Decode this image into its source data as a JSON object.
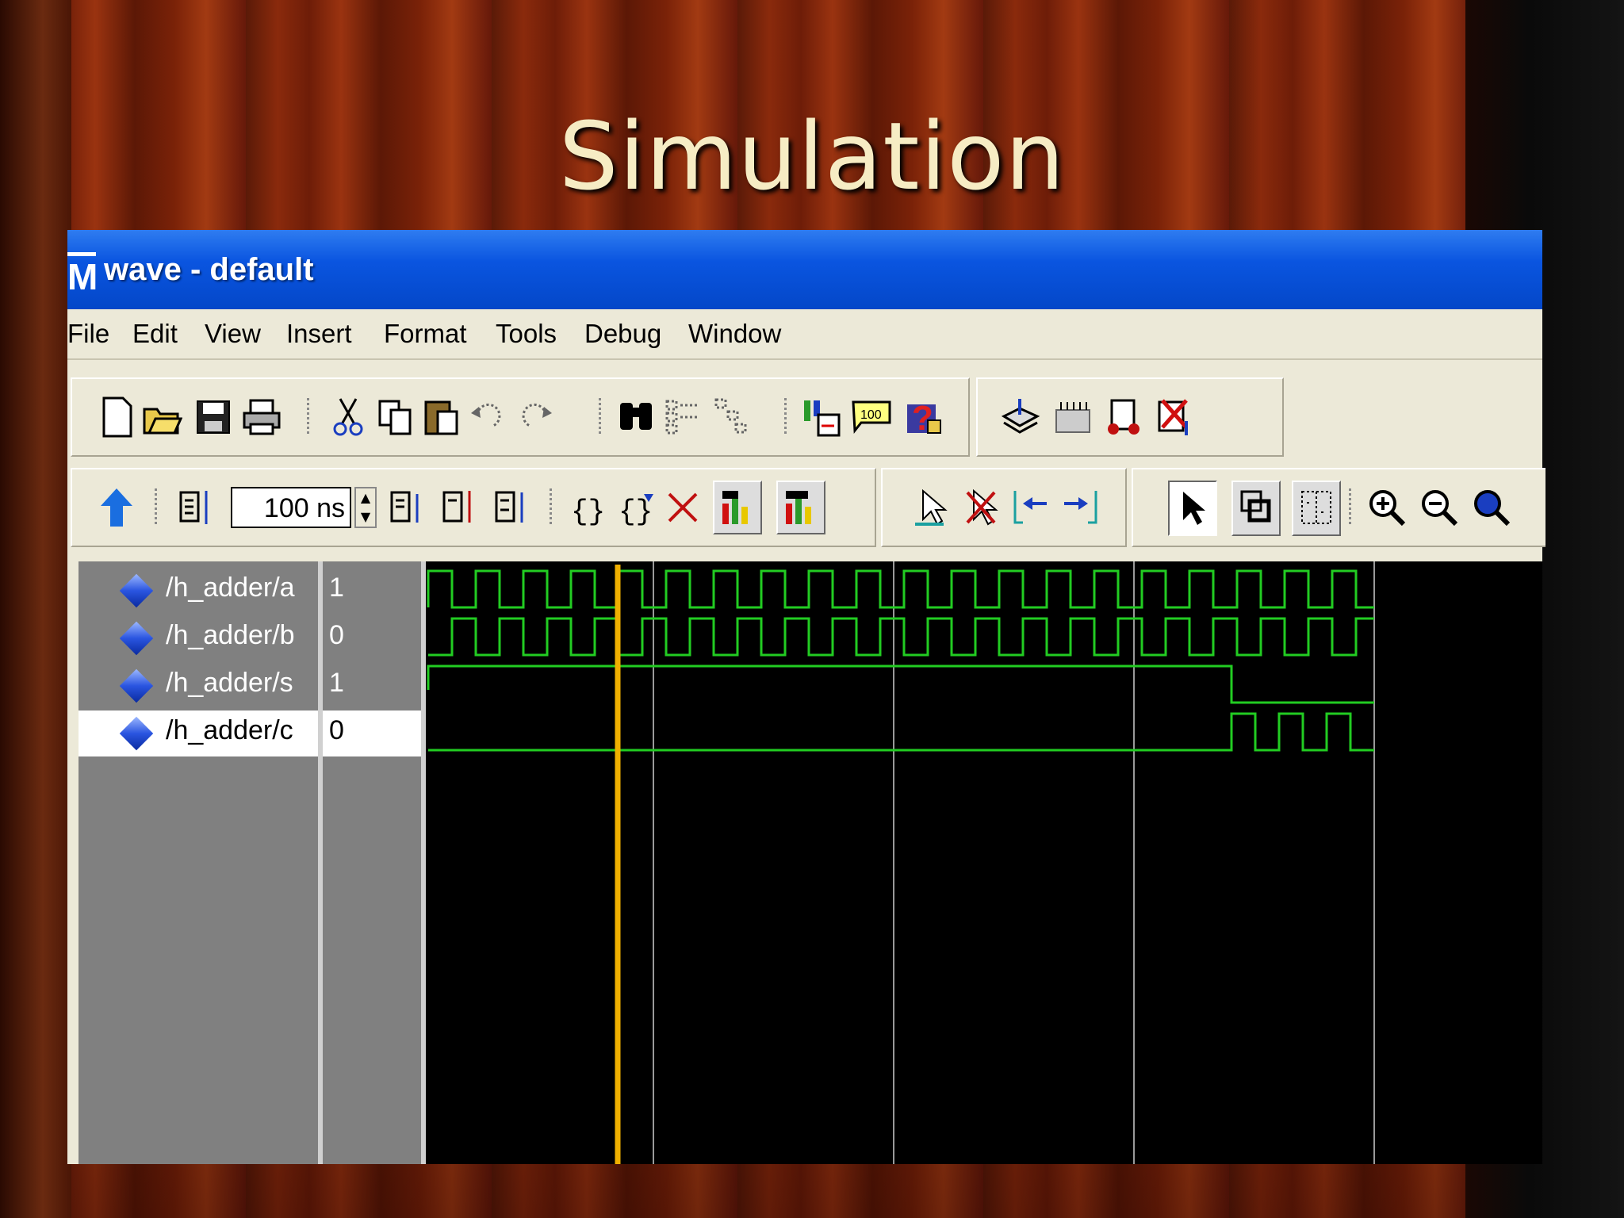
{
  "slide": {
    "title": "Simulation"
  },
  "window": {
    "icon": "M",
    "title": "wave - default"
  },
  "menu": [
    "File",
    "Edit",
    "View",
    "Insert",
    "Format",
    "Tools",
    "Debug",
    "Window"
  ],
  "toolbar": {
    "time_step_value": "100 ns"
  },
  "signals": [
    {
      "name": "/h_adder/a",
      "value": "1"
    },
    {
      "name": "/h_adder/b",
      "value": "0"
    },
    {
      "name": "/h_adder/s",
      "value": "1"
    },
    {
      "name": "/h_adder/c",
      "value": "0"
    }
  ],
  "colors": {
    "wave": "#22cc22",
    "cursor": "#f0b000",
    "grid": "#9a9a9a",
    "titlebar": "#0a55e0"
  },
  "icons": [
    "new-file-icon",
    "open-folder-icon",
    "save-icon",
    "print-icon",
    "cut-icon",
    "copy-icon",
    "paste-icon",
    "undo-icon",
    "redo-icon",
    "find-icon",
    "signal-list-icon",
    "structure-icon",
    "wave-add-icon",
    "dataflow-icon",
    "help-icon",
    "load-icon",
    "memory-icon",
    "process-icon",
    "delete-icon",
    "up-arrow-icon",
    "zoom-in-icon",
    "zoom-out-icon",
    "zoom-full-icon",
    "select-pointer-icon"
  ]
}
